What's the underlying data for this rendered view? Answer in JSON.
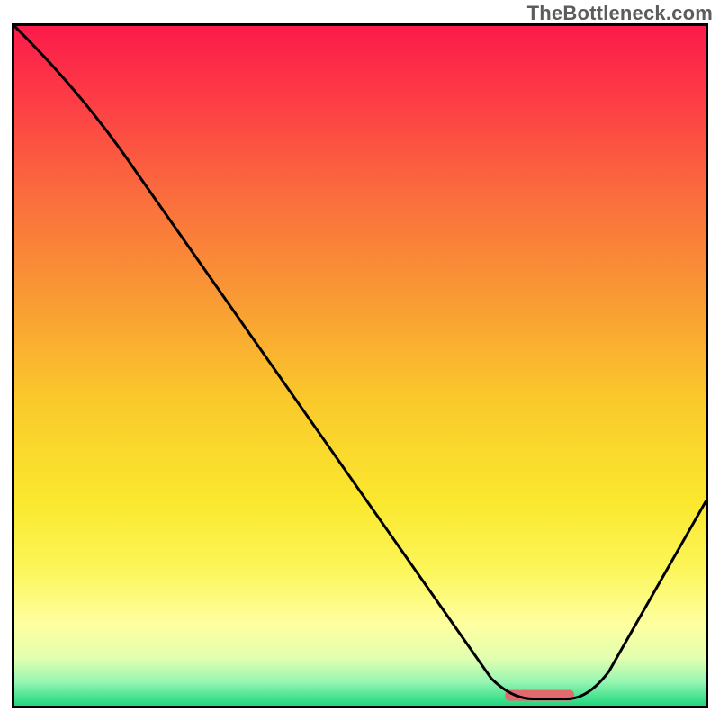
{
  "watermark": "TheBottleneck.com",
  "chart_data": {
    "type": "line",
    "title": "",
    "xlabel": "",
    "ylabel": "",
    "xlim": [
      0,
      100
    ],
    "ylim": [
      0,
      100
    ],
    "series": [
      {
        "name": "curve",
        "x": [
          0,
          18,
          72,
          82,
          100
        ],
        "y": [
          100,
          78,
          1,
          1,
          30
        ]
      }
    ],
    "marker": {
      "name": "highlight-segment",
      "x_range": [
        71,
        81
      ],
      "y": 1.5,
      "color": "#e16a6f"
    },
    "background_gradient": {
      "stops": [
        {
          "offset": 0.0,
          "color": "#fc1b4a"
        },
        {
          "offset": 0.1,
          "color": "#fd3a46"
        },
        {
          "offset": 0.25,
          "color": "#fa6d3d"
        },
        {
          "offset": 0.4,
          "color": "#f99a34"
        },
        {
          "offset": 0.55,
          "color": "#fac92b"
        },
        {
          "offset": 0.7,
          "color": "#fbe82e"
        },
        {
          "offset": 0.8,
          "color": "#fcf65a"
        },
        {
          "offset": 0.88,
          "color": "#feffa0"
        },
        {
          "offset": 0.93,
          "color": "#e3ffb0"
        },
        {
          "offset": 0.965,
          "color": "#96f6b2"
        },
        {
          "offset": 1.0,
          "color": "#1fd77e"
        }
      ]
    }
  }
}
